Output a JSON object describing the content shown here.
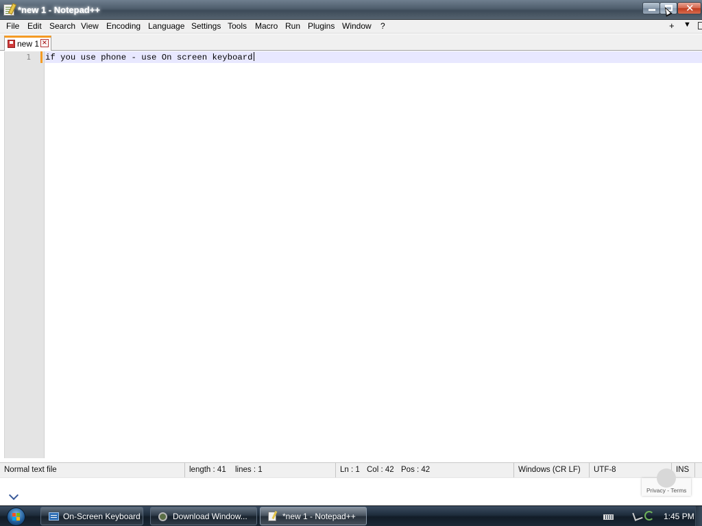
{
  "window": {
    "title": "*new 1 - Notepad++",
    "close_glyph": "✕"
  },
  "menu": {
    "items": [
      "File",
      "Edit",
      "Search",
      "View",
      "Encoding",
      "Language",
      "Settings",
      "Tools",
      "Macro",
      "Run",
      "Plugins",
      "Window",
      "?"
    ],
    "right_plus": "+",
    "right_arrow": "▼"
  },
  "tabs": [
    {
      "label": "new 1",
      "close_glyph": "×",
      "modified": true
    }
  ],
  "editor": {
    "line_numbers": [
      "1"
    ],
    "lines": [
      "if you use phone - use On screen keyboard"
    ]
  },
  "status": {
    "file_type": "Normal text file",
    "length": "length : 41",
    "lines": "lines : 1",
    "ln": "Ln : 1",
    "col": "Col : 42",
    "pos": "Pos : 42",
    "eol": "Windows (CR LF)",
    "encoding": "UTF-8",
    "mode": "INS"
  },
  "recaptcha": {
    "text": "Privacy - Terms"
  },
  "taskbar": {
    "buttons": [
      {
        "label": "On-Screen Keyboard",
        "icon": "keyboard-icon",
        "active": false
      },
      {
        "label": "Download Window...",
        "icon": "download-icon",
        "active": false
      },
      {
        "label": "*new 1 - Notepad++",
        "icon": "notepad-icon",
        "active": true
      }
    ],
    "clock": "1:45 PM"
  },
  "colors": {
    "tab_accent": "#f59a23",
    "current_line": "#e8e8ff",
    "gutter": "#e4e4e4"
  }
}
